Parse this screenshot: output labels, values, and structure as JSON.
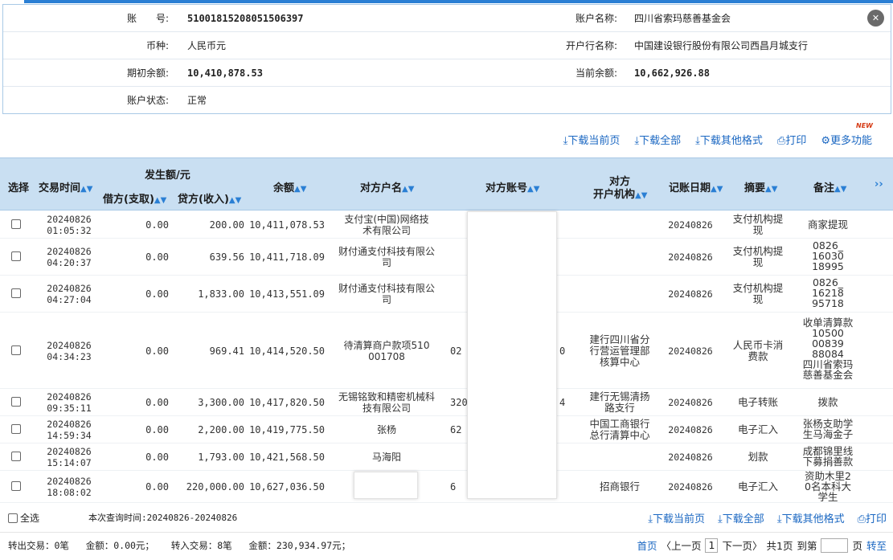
{
  "account": {
    "number_label": "账　　号:",
    "number": "51001815208051506397",
    "name_label": "账户名称:",
    "name": "四川省索玛慈善基金会",
    "currency_label": "币种:",
    "currency": "人民币元",
    "bank_label": "开户行名称:",
    "bank": "中国建设银行股份有限公司西昌月城支行",
    "opening_balance_label": "期初余额:",
    "opening_balance": "10,410,878.53",
    "current_balance_label": "当前余额:",
    "current_balance": "10,662,926.88",
    "status_label": "账户状态:",
    "status": "正常"
  },
  "toolbar": {
    "download_page": "下载当前页",
    "download_all": "下载全部",
    "download_other": "下载其他格式",
    "print": "打印",
    "more": "更多功能",
    "new_badge": "NEW"
  },
  "table": {
    "headers": {
      "select": "选择",
      "time": "交易时间",
      "amount_group": "发生额/元",
      "debit": "借方(支取)",
      "credit": "贷方(收入)",
      "balance": "余额",
      "counterparty_name": "对方户名",
      "counterparty_account": "对方账号",
      "counterparty_bank_1": "对方",
      "counterparty_bank_2": "开户机构",
      "post_date": "记账日期",
      "summary": "摘要",
      "remark": "备注",
      "more": "››"
    },
    "rows": [
      {
        "date": "20240826",
        "time": "01:05:32",
        "debit": "0.00",
        "credit": "200.00",
        "balance": "10,411,078.53",
        "name1": "支付宝(中国)网络技",
        "name2": "术有限公司",
        "acct": "",
        "bank1": "",
        "bank2": "",
        "bank3": "",
        "post": "20240826",
        "sum1": "支付机构提",
        "sum2": "现",
        "rem": [
          "商家提现"
        ]
      },
      {
        "date": "20240826",
        "time": "04:20:37",
        "debit": "0.00",
        "credit": "639.56",
        "balance": "10,411,718.09",
        "name1": "财付通支付科技有限公",
        "name2": "司",
        "acct": "",
        "bank1": "",
        "bank2": "",
        "bank3": "",
        "post": "20240826",
        "sum1": "支付机构提",
        "sum2": "现",
        "rem": [
          "0826_",
          "16030",
          "18995"
        ]
      },
      {
        "date": "20240826",
        "time": "04:27:04",
        "debit": "0.00",
        "credit": "1,833.00",
        "balance": "10,413,551.09",
        "name1": "财付通支付科技有限公",
        "name2": "司",
        "acct": "",
        "bank1": "",
        "bank2": "",
        "bank3": "",
        "post": "20240826",
        "sum1": "支付机构提",
        "sum2": "现",
        "rem": [
          "0826_",
          "16218",
          "95718"
        ]
      },
      {
        "date": "20240826",
        "time": "04:34:23",
        "debit": "0.00",
        "credit": "969.41",
        "balance": "10,414,520.50",
        "name1": "待清算商户款项510",
        "name2": "001708",
        "acct": "02",
        "acct_tail": "0",
        "bank1": "建行四川省分",
        "bank2": "行营运管理部",
        "bank3": "核算中心",
        "post": "20240826",
        "sum1": "人民币卡消",
        "sum2": "费款",
        "rem": [
          "收单清算款",
          "10500",
          "00839",
          "88084",
          "四川省索玛",
          "慈善基金会"
        ]
      },
      {
        "date": "20240826",
        "time": "09:35:11",
        "debit": "0.00",
        "credit": "3,300.00",
        "balance": "10,417,820.50",
        "name1": "无锡铭致和精密机械科",
        "name2": "技有限公司",
        "acct": "320",
        "acct_tail": "4",
        "bank1": "建行无锡清扬",
        "bank2": "路支行",
        "bank3": "",
        "post": "20240826",
        "sum1": "电子转账",
        "sum2": "",
        "rem": [
          "拨款"
        ]
      },
      {
        "date": "20240826",
        "time": "14:59:34",
        "debit": "0.00",
        "credit": "2,200.00",
        "balance": "10,419,775.50",
        "name1": "张杨",
        "name2": "",
        "acct": "62",
        "acct_tail": "",
        "bank1": "中国工商银行",
        "bank2": "总行清算中心",
        "bank3": "",
        "post": "20240826",
        "sum1": "电子汇入",
        "sum2": "",
        "rem": [
          "张杨支助学",
          "生马海金子"
        ]
      },
      {
        "date": "20240826",
        "time": "15:14:07",
        "debit": "0.00",
        "credit": "1,793.00",
        "balance": "10,421,568.50",
        "name1": "马海阳",
        "name2": "",
        "acct": "",
        "acct_tail": "",
        "bank1": "",
        "bank2": "",
        "bank3": "",
        "post": "20240826",
        "sum1": "划款",
        "sum2": "",
        "rem": [
          "成都锦里线",
          "下募捐善款"
        ]
      },
      {
        "date": "20240826",
        "time": "18:08:02",
        "debit": "0.00",
        "credit": "220,000.00",
        "balance": "10,627,036.50",
        "name1": "",
        "name2": "",
        "acct": "6",
        "acct_tail": "",
        "bank1": "招商银行",
        "bank2": "",
        "bank3": "",
        "post": "20240826",
        "sum1": "电子汇入",
        "sum2": "",
        "rem": [
          "资助木里2",
          "0名本科大",
          "学生"
        ]
      }
    ]
  },
  "footer": {
    "select_all": "全选",
    "query_time": "本次查询时间:20240826-20240826",
    "download_page": "下载当前页",
    "download_all": "下载全部",
    "download_other": "下载其他格式",
    "print": "打印",
    "out_count": "转出交易：0笔",
    "out_amount": "金额：0.00元；",
    "in_count": "转入交易：8笔",
    "in_amount": "金额：230,934.97元；",
    "first": "首页",
    "prev": "〈上一页",
    "current_page": "1",
    "next": "下一页〉",
    "total": "共1页",
    "goto_label": "到第",
    "page_unit": "页",
    "goto": "转至"
  }
}
